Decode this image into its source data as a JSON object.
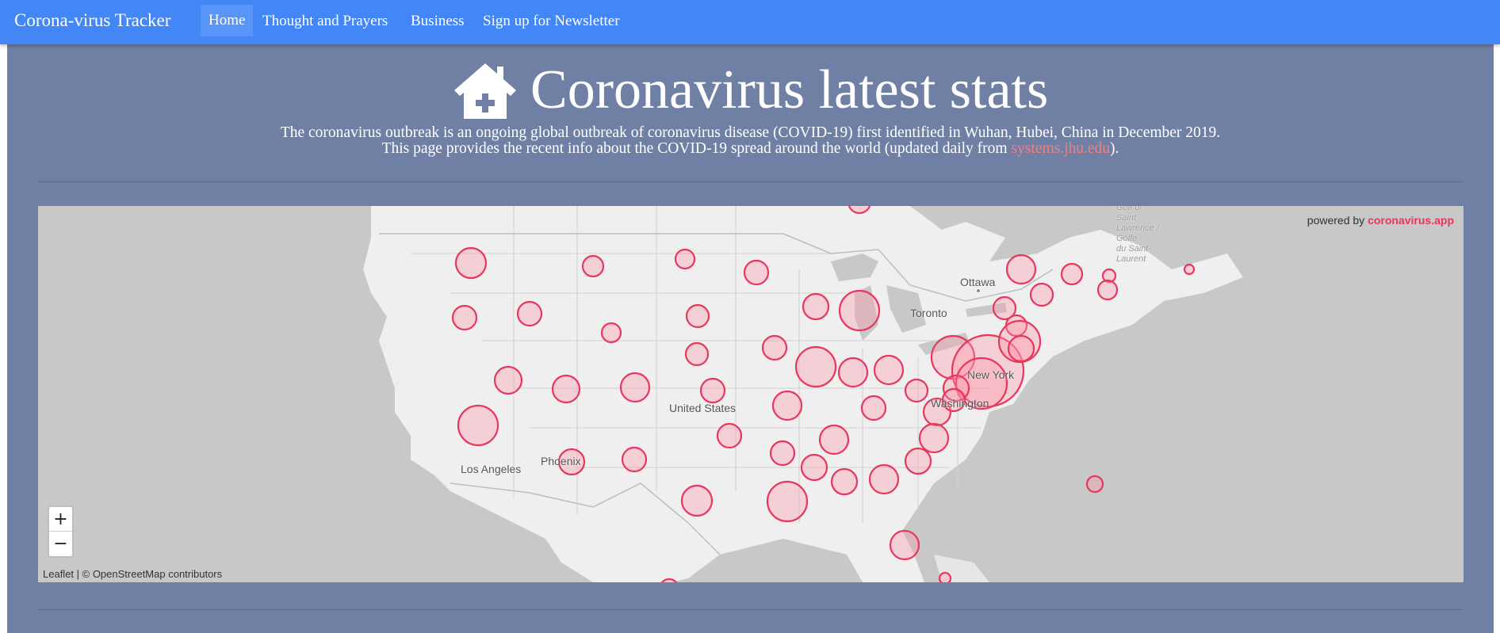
{
  "navbar": {
    "brand": "Corona-virus Tracker",
    "items": [
      "Home",
      "Thought and Prayers",
      "Business",
      "Sign up for Newsletter"
    ],
    "active_item": "Home"
  },
  "header": {
    "title": "Coronavirus latest stats",
    "icon": "house-medical-icon",
    "description_line1": "The coronavirus outbreak is an ongoing global outbreak of coronavirus disease (COVID-19) first identified in Wuhan, Hubei, China in December 2019.",
    "description_line2_prefix": "This page provides the recent info about the COVID-19 spread around the world (updated daily from ",
    "description_link": "systems.jhu.edu",
    "description_line2_suffix": ")."
  },
  "map": {
    "powered_by_prefix": "powered by ",
    "powered_by_link": "coronavirus.app",
    "zoom_in": "+",
    "zoom_out": "−",
    "attribution": "Leaflet | © OpenStreetMap contributors",
    "labels": {
      "ottawa": "Ottawa",
      "toronto": "Toronto",
      "new_york": "New York",
      "washington": "Washington",
      "united_states": "United States",
      "phoenix": "Phoenix",
      "los_angeles": "Los Angeles",
      "gulf": "Golfe du Saint-Laurent",
      "gulf_line1": "Gulf of",
      "gulf_line2": "Saint",
      "gulf_line3": "Lawrence /",
      "gulf_line4": "Golfe",
      "gulf_line5": "du Saint-",
      "gulf_line6": "Laurent"
    },
    "colors": {
      "bubble_stroke": "#e8365d",
      "bubble_fill": "#ffb3c3",
      "land": "#efefef",
      "water": "#c8c8c8"
    }
  }
}
